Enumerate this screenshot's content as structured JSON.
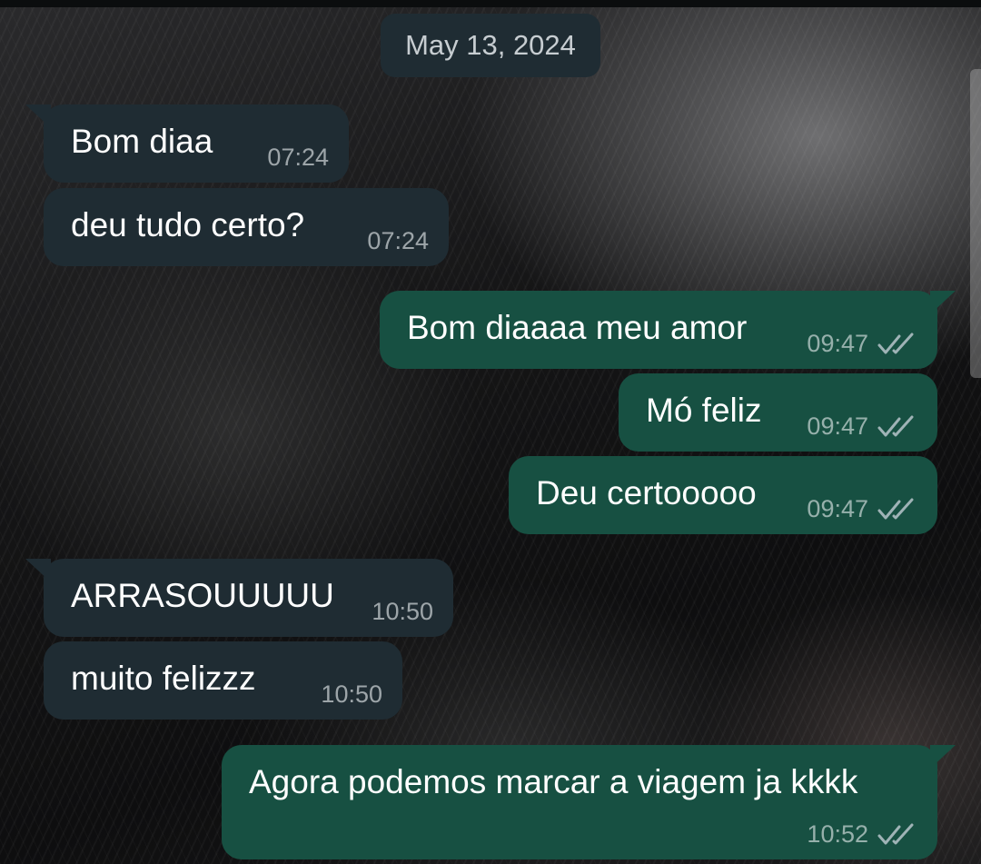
{
  "date_separator": "May 13, 2024",
  "messages": [
    {
      "direction": "in",
      "text": "Bom diaa",
      "time": "07:24"
    },
    {
      "direction": "in",
      "text": "deu tudo certo?",
      "time": "07:24"
    },
    {
      "direction": "out",
      "text": "Bom diaaaa meu amor",
      "time": "09:47",
      "status": "read-double-check-icon"
    },
    {
      "direction": "out",
      "text": "Mó feliz",
      "time": "09:47",
      "status": "read-double-check-icon"
    },
    {
      "direction": "out",
      "text": "Deu certooooo",
      "time": "09:47",
      "status": "read-double-check-icon"
    },
    {
      "direction": "in",
      "text": "ARRASOUUUUU",
      "time": "10:50"
    },
    {
      "direction": "in",
      "text": "muito felizzz",
      "time": "10:50"
    },
    {
      "direction": "out",
      "text": "Agora podemos marcar a viagem ja kkkk",
      "time": "10:52",
      "status": "read-double-check-icon"
    }
  ],
  "colors": {
    "incoming_bubble": "#1f2c33",
    "outgoing_bubble": "#175042",
    "date_chip": "#1f2c33",
    "meta_text": "#9aa3a8"
  }
}
